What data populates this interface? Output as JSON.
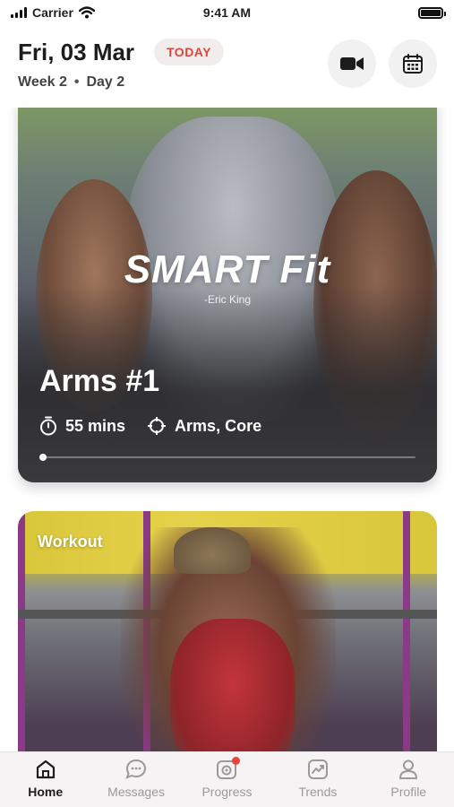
{
  "status_bar": {
    "carrier": "Carrier",
    "time": "9:41 AM"
  },
  "header": {
    "date": "Fri, 03 Mar",
    "badge": "TODAY",
    "week": "Week 2",
    "separator": "•",
    "day": "Day 2",
    "video_icon": "video-camera-icon",
    "calendar_icon": "calendar-icon"
  },
  "featured": {
    "brand": "SMART Fit",
    "brand_sub": "-Eric King",
    "title": "Arms #1",
    "duration": "55 mins",
    "focus": "Arms, Core",
    "progress": 0.02
  },
  "next_card": {
    "label": "Workout"
  },
  "tabs": [
    {
      "label": "Home",
      "icon": "home-icon",
      "active": true
    },
    {
      "label": "Messages",
      "icon": "chat-icon",
      "active": false
    },
    {
      "label": "Progress",
      "icon": "camera-icon",
      "active": false,
      "badge": true
    },
    {
      "label": "Trends",
      "icon": "trend-icon",
      "active": false
    },
    {
      "label": "Profile",
      "icon": "profile-icon",
      "active": false
    }
  ],
  "colors": {
    "accent": "#e0453b",
    "badge_bg": "#f1eded",
    "active_tab": "#1e1e1e",
    "inactive_tab": "#9a9a9a"
  }
}
